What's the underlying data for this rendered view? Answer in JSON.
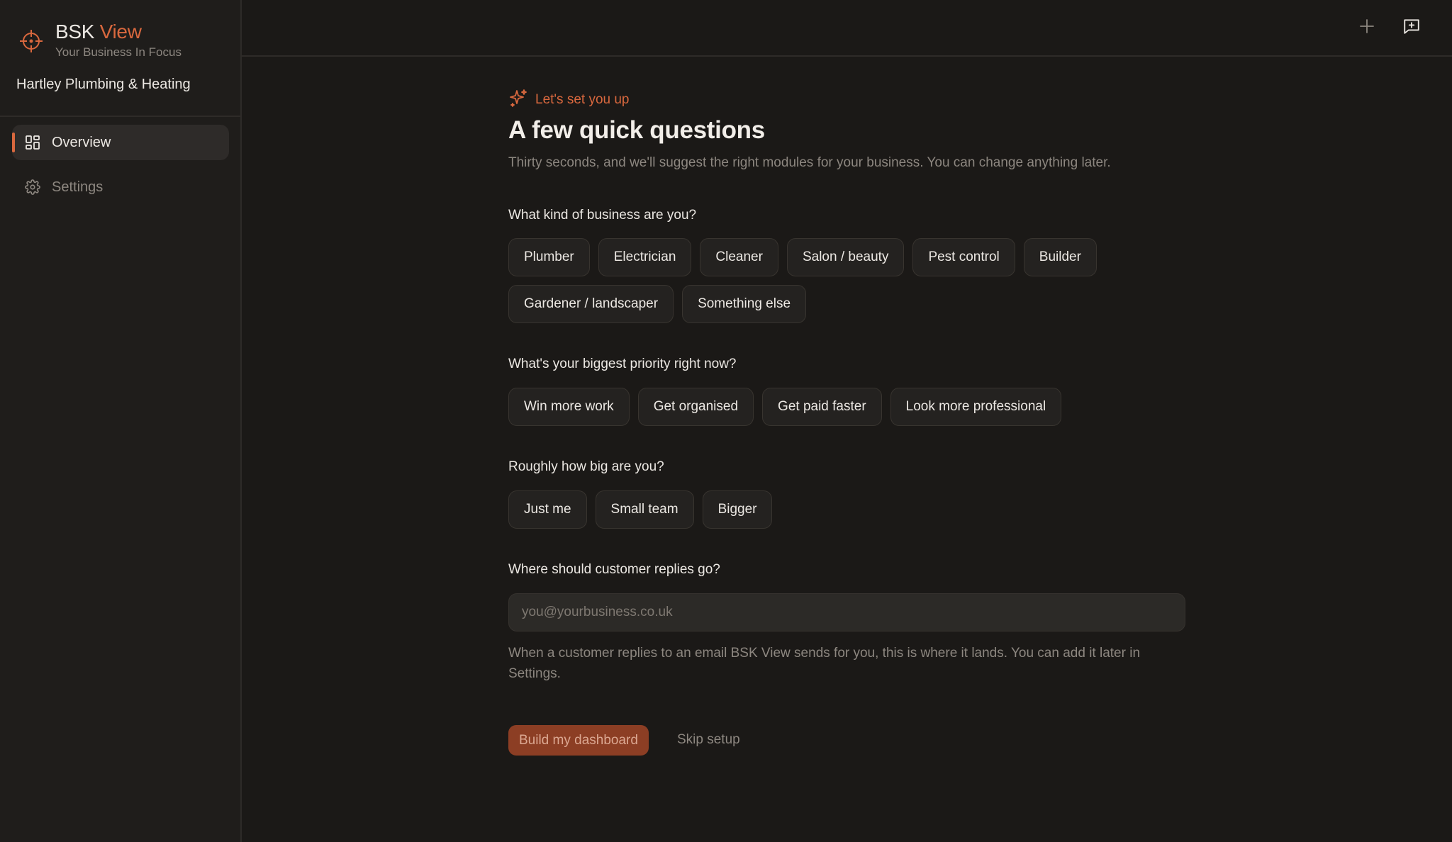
{
  "brand": {
    "name_main": "BSK",
    "name_accent": "View",
    "tagline": "Your Business In Focus",
    "logo_icon": "crosshair-icon",
    "accent_color": "#d9683e"
  },
  "sidebar": {
    "company": "Hartley Plumbing & Heating",
    "items": [
      {
        "label": "Overview",
        "icon": "grid-icon",
        "active": true
      },
      {
        "label": "Settings",
        "icon": "gear-icon",
        "active": false
      }
    ]
  },
  "topbar": {
    "actions": [
      {
        "icon": "plus-icon"
      },
      {
        "icon": "message-plus-icon"
      }
    ]
  },
  "setup": {
    "eyebrow": "Let's set you up",
    "title": "A few quick questions",
    "subtitle": "Thirty seconds, and we'll suggest the right modules for your business. You can change anything later.",
    "q1": {
      "label": "What kind of business are you?",
      "options": [
        "Plumber",
        "Electrician",
        "Cleaner",
        "Salon / beauty",
        "Pest control",
        "Builder",
        "Gardener / landscaper",
        "Something else"
      ]
    },
    "q2": {
      "label": "What's your biggest priority right now?",
      "options": [
        "Win more work",
        "Get organised",
        "Get paid faster",
        "Look more professional"
      ]
    },
    "q3": {
      "label": "Roughly how big are you?",
      "options": [
        "Just me",
        "Small team",
        "Bigger"
      ]
    },
    "q4": {
      "label": "Where should customer replies go?",
      "placeholder": "you@yourbusiness.co.uk",
      "value": "",
      "help": "When a customer replies to an email BSK View sends for you, this is where it lands. You can add it later in Settings."
    },
    "primary_button": "Build my dashboard",
    "skip_link": "Skip setup"
  }
}
